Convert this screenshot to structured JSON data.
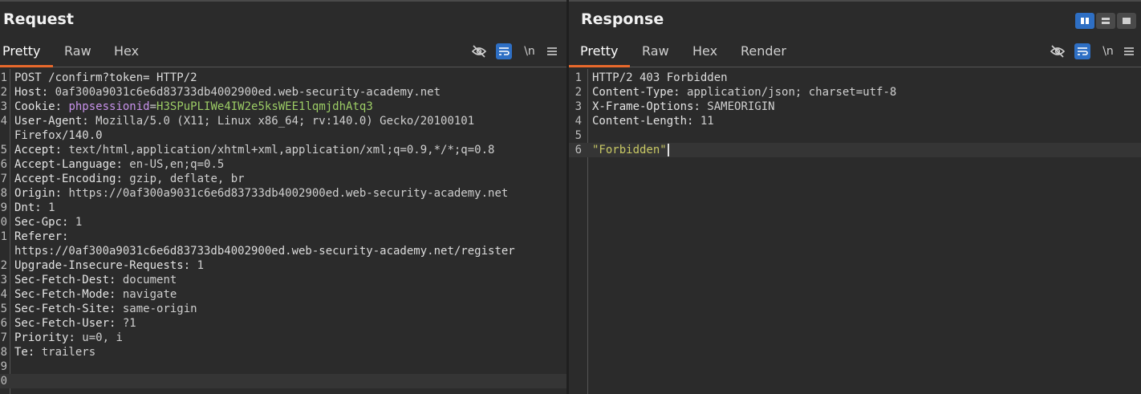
{
  "request": {
    "title": "Request",
    "tabs": [
      "Pretty",
      "Raw",
      "Hex"
    ],
    "active_tab": "Pretty",
    "lines": [
      {
        "n": "1",
        "text": "POST /confirm?token= HTTP/2"
      },
      {
        "n": "2",
        "name": "Host",
        "value": "0af300a9031c6e6d83733db4002900ed.web-security-academy.net"
      },
      {
        "n": "3",
        "name": "Cookie",
        "cookie_name": "phpsessionid",
        "cookie_value": "H3SPuPLIWe4IW2e5ksWEE1lqmjdhAtq3"
      },
      {
        "n": "4",
        "name": "User-Agent",
        "value": "Mozilla/5.0 (X11; Linux x86_64; rv:140.0) Gecko/20100101"
      },
      {
        "n": "",
        "text": "Firefox/140.0"
      },
      {
        "n": "5",
        "name": "Accept",
        "value": "text/html,application/xhtml+xml,application/xml;q=0.9,*/*;q=0.8"
      },
      {
        "n": "6",
        "name": "Accept-Language",
        "value": "en-US,en;q=0.5"
      },
      {
        "n": "7",
        "name": "Accept-Encoding",
        "value": "gzip, deflate, br"
      },
      {
        "n": "8",
        "name": "Origin",
        "value": "https://0af300a9031c6e6d83733db4002900ed.web-security-academy.net"
      },
      {
        "n": "9",
        "name": "Dnt",
        "value": "1"
      },
      {
        "n": "0",
        "name": "Sec-Gpc",
        "value": "1"
      },
      {
        "n": "1",
        "name": "Referer",
        "value": ""
      },
      {
        "n": "",
        "text": "https://0af300a9031c6e6d83733db4002900ed.web-security-academy.net/register"
      },
      {
        "n": "2",
        "name": "Upgrade-Insecure-Requests",
        "value": "1"
      },
      {
        "n": "3",
        "name": "Sec-Fetch-Dest",
        "value": "document"
      },
      {
        "n": "4",
        "name": "Sec-Fetch-Mode",
        "value": "navigate"
      },
      {
        "n": "5",
        "name": "Sec-Fetch-Site",
        "value": "same-origin"
      },
      {
        "n": "6",
        "name": "Sec-Fetch-User",
        "value": "?1"
      },
      {
        "n": "7",
        "name": "Priority",
        "value": "u=0, i"
      },
      {
        "n": "8",
        "name": "Te",
        "value": "trailers"
      },
      {
        "n": "9",
        "text": ""
      },
      {
        "n": "0",
        "text": "",
        "current": true
      }
    ]
  },
  "response": {
    "title": "Response",
    "tabs": [
      "Pretty",
      "Raw",
      "Hex",
      "Render"
    ],
    "active_tab": "Pretty",
    "lines": [
      {
        "n": "1",
        "text": "HTTP/2 403 Forbidden"
      },
      {
        "n": "2",
        "name": "Content-Type",
        "value": "application/json; charset=utf-8"
      },
      {
        "n": "3",
        "name": "X-Frame-Options",
        "value": "SAMEORIGIN"
      },
      {
        "n": "4",
        "name": "Content-Length",
        "value": "11"
      },
      {
        "n": "5",
        "text": ""
      },
      {
        "n": "6",
        "string": "\"Forbidden\"",
        "current": true
      }
    ]
  },
  "toolbar_icons": [
    "hide-eye-icon",
    "wrap-lines-icon",
    "newline-icon",
    "menu-icon"
  ],
  "newline_label": "\\n",
  "colors": {
    "accent": "#e8692c",
    "active_tool": "#2e6fc4",
    "cookie_name": "#c792ea",
    "cookie_value": "#9ccc65",
    "string": "#c8c864"
  }
}
